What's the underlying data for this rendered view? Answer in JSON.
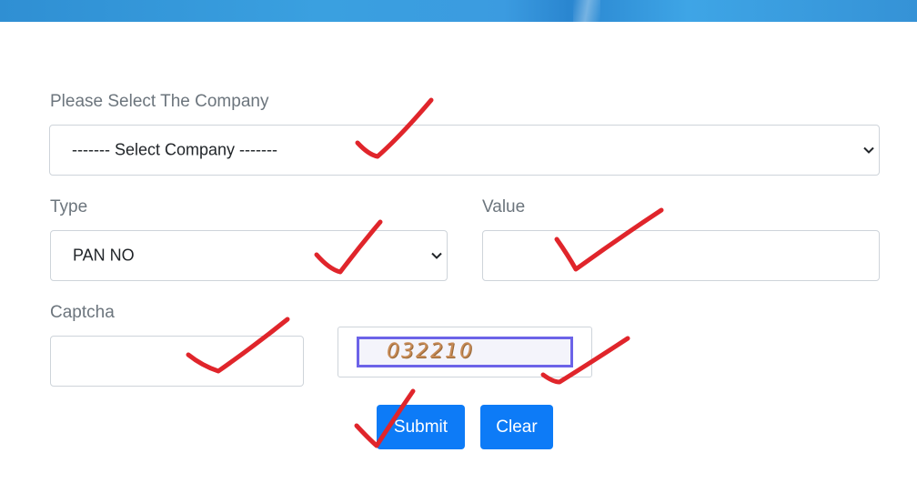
{
  "form": {
    "company_label": "Please Select The Company",
    "company_select_value": "------- Select Company -------",
    "type_label": "Type",
    "type_select_value": "PAN NO",
    "value_label": "Value",
    "value_input": "",
    "captcha_label": "Captcha",
    "captcha_input": "",
    "captcha_code": "032210",
    "submit_label": "Submit",
    "clear_label": "Clear"
  },
  "colors": {
    "button_primary": "#0d7bf7",
    "checkmark": "#e0252b",
    "banner": "#3aa0e0"
  },
  "icons": {
    "select_arrow": "chevron-down-icon",
    "annotation": "checkmark-icon"
  }
}
